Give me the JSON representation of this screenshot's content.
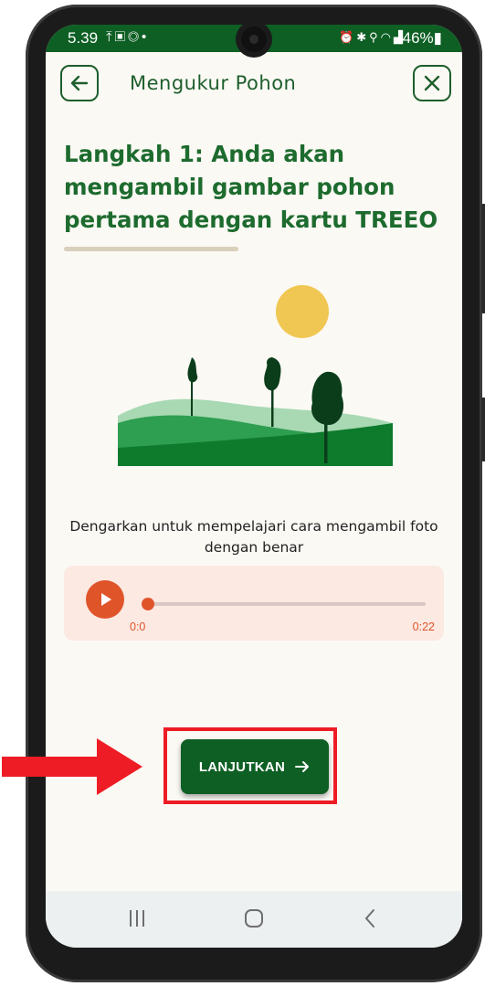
{
  "status_bar": {
    "time": "5.39",
    "battery": "46%",
    "left_icons": [
      "upload-icon",
      "image-icon",
      "whatsapp-icon",
      "dot-icon"
    ],
    "right_icons": [
      "alarm-icon",
      "bluetooth-icon",
      "location-icon",
      "wifi-icon",
      "signal-icon",
      "battery-icon"
    ]
  },
  "header": {
    "title": "Mengukur Pohon",
    "back_icon": "arrow-left-icon",
    "close_icon": "close-icon"
  },
  "step": {
    "title": "Langkah 1: Anda akan mengambil gambar pohon pertama dengan kartu TREEO"
  },
  "audio": {
    "caption": "Dengarkan untuk mempelajari cara mengambil foto dengan benar",
    "current_time": "0:0",
    "duration": "0:22",
    "progress": 0
  },
  "actions": {
    "continue_label": "LANJUTKAN"
  },
  "colors": {
    "primary": "#0e5f24",
    "accent": "#e0542a",
    "background": "#fbf9f4",
    "audio_card": "#fbe9e2",
    "highlight": "#ee1c24"
  }
}
